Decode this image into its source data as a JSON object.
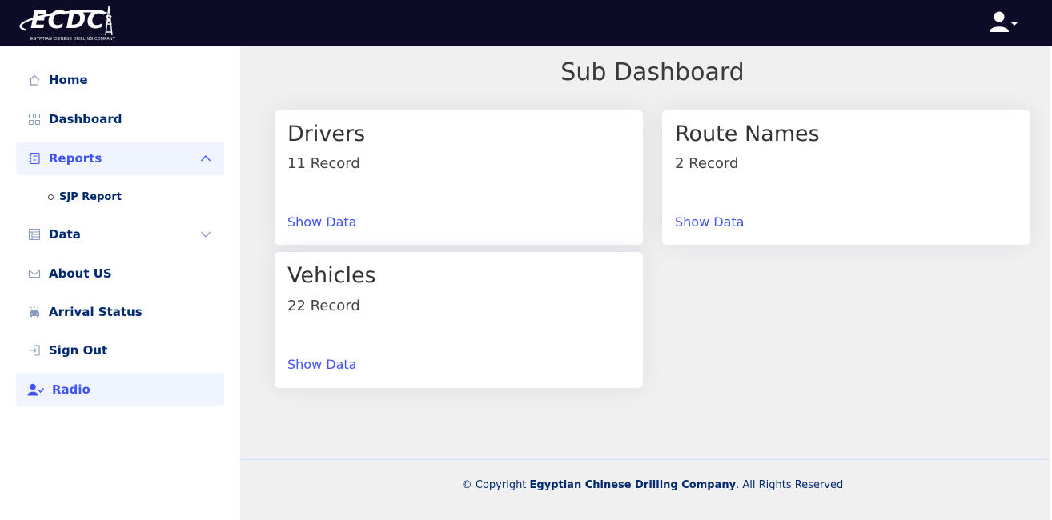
{
  "header": {
    "logo_text": "ECDC",
    "logo_subtitle": "EGYPTIAN CHINESE DRILLING COMPANY",
    "user_menu_icon": "user-icon"
  },
  "sidebar": {
    "items": [
      {
        "label": "Home",
        "icon": "home-icon"
      },
      {
        "label": "Dashboard",
        "icon": "grid-icon"
      },
      {
        "label": "Reports",
        "icon": "journal-icon",
        "expanded": true
      },
      {
        "label": "Data",
        "icon": "table-icon",
        "expanded": false
      },
      {
        "label": "About US",
        "icon": "envelope-icon"
      },
      {
        "label": "Arrival Status",
        "icon": "car-alarm-icon"
      },
      {
        "label": "Sign Out",
        "icon": "sign-in-icon"
      },
      {
        "label": "Radio",
        "icon": "person-check-icon",
        "active": true
      }
    ],
    "reports_children": [
      {
        "label": "SJP Report"
      }
    ]
  },
  "main": {
    "title": "Sub Dashboard",
    "cards": [
      {
        "title": "Drivers",
        "count": "11 Record",
        "link": "Show Data"
      },
      {
        "title": "Route Names",
        "count": "2 Record",
        "link": "Show Data"
      },
      {
        "title": "Vehicles",
        "count": "22 Record",
        "link": "Show Data"
      }
    ]
  },
  "footer": {
    "prefix": "© Copyright ",
    "company": "Egyptian Chinese Drilling Company",
    "suffix": ". All Rights Reserved"
  },
  "colors": {
    "header_bg": "#0d0b26",
    "accent": "#4154f1",
    "nav_text": "#012970",
    "main_bg": "#f0f0f0"
  }
}
